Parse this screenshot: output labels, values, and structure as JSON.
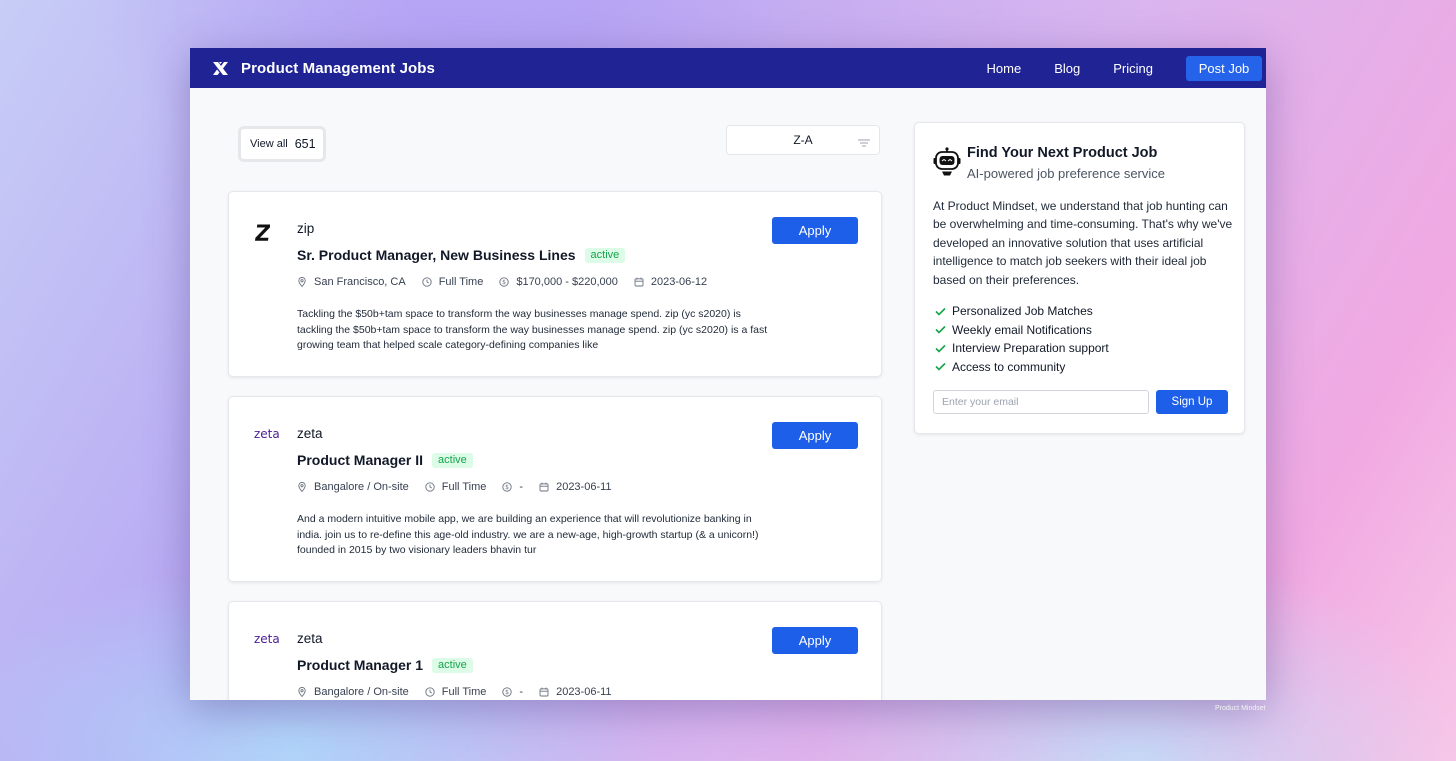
{
  "app": {
    "title": "Product Management Jobs",
    "nav": [
      "Home",
      "Blog",
      "Pricing"
    ],
    "post_job_label": "Post Job"
  },
  "filters": {
    "view_all_label": "View all",
    "view_all_count": "651",
    "sort_value": "Z-A"
  },
  "jobs": [
    {
      "company": "zip",
      "logo_icon": "zip-logo-icon",
      "title": "Sr. Product Manager, New Business Lines",
      "status": "active",
      "location": "San Francisco, CA",
      "type": "Full Time",
      "salary": "$170,000 - $220,000",
      "date": "2023-06-12",
      "description": "Tackling the $50b+tam space to transform the way businesses manage spend. zip (yc s2020) is tackling the $50b+tam space to transform the way businesses manage spend. zip (yc s2020) is a fast growing team that helped scale category-defining companies like",
      "apply_label": "Apply"
    },
    {
      "company": "zeta",
      "logo_icon": "zeta-logo-icon",
      "logo_text": "zeta",
      "title": "Product Manager II",
      "status": "active",
      "location": "Bangalore / On-site",
      "type": "Full Time",
      "salary": "-",
      "date": "2023-06-11",
      "description": "And a modern intuitive mobile app, we are building an experience that will revolutionize banking in india. join us to re-define this age-old industry. we are a new-age, high-growth startup (& a unicorn!) founded in 2015 by two visionary leaders bhavin tur",
      "apply_label": "Apply"
    },
    {
      "company": "zeta",
      "logo_icon": "zeta-logo-icon",
      "logo_text": "zeta",
      "title": "Product Manager 1",
      "status": "active",
      "location": "Bangalore / On-site",
      "type": "Full Time",
      "salary": "-",
      "date": "2023-06-11",
      "description": "",
      "apply_label": "Apply"
    }
  ],
  "sidebar": {
    "icon": "robot-icon",
    "title": "Find Your Next Product Job",
    "subtitle": "AI-powered job preference service",
    "body": "At Product Mindset, we understand that job hunting can be overwhelming and time-consuming. That's why we've developed an innovative solution that uses artificial intelligence to match job seekers with their ideal job based on their preferences.",
    "features": [
      "Personalized Job Matches",
      "Weekly email Notifications",
      "Interview Preparation support",
      "Access to community"
    ],
    "email_placeholder": "Enter your email",
    "signup_label": "Sign Up"
  },
  "watermark": "Product Mindset",
  "colors": {
    "navbar": "#1f2394",
    "primary_button": "#1d5fe8",
    "badge_bg": "#dcfce7",
    "badge_text": "#16a34a",
    "check": "#16a34a"
  }
}
